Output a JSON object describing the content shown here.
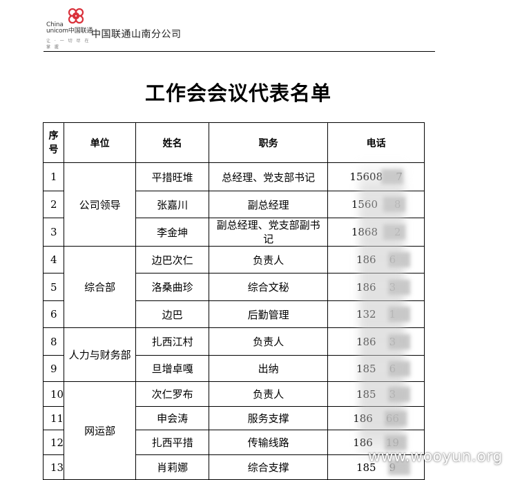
{
  "header": {
    "brand_en_line1": "China",
    "brand_en_line2": "unicom中国联通",
    "slogan": "让 · 一 切 尽 在 掌 握",
    "company": "中国联通山南分公司"
  },
  "title": "工作会会议代表名单",
  "table": {
    "headers": {
      "seq_line1": "序",
      "seq_line2": "号",
      "unit": "单位",
      "name": "姓名",
      "duty": "职务",
      "phone": "电话"
    },
    "groups": [
      {
        "unit": "公司领导",
        "rows": [
          {
            "seq": "1",
            "name": "平措旺堆",
            "duty": "总经理、党支部书记",
            "phone": "15608    7"
          },
          {
            "seq": "2",
            "name": "张嘉川",
            "duty": "副总经理",
            "phone": "1560     8"
          },
          {
            "seq": "3",
            "name": "李金坤",
            "duty": "副总经理、党支部副书记",
            "phone": "1868     2"
          }
        ]
      },
      {
        "unit": "综合部",
        "rows": [
          {
            "seq": "4",
            "name": "边巴次仁",
            "duty": "负责人",
            "phone": "186    6"
          },
          {
            "seq": "5",
            "name": "洛桑曲珍",
            "duty": "综合文秘",
            "phone": "186    3"
          },
          {
            "seq": "6",
            "name": "边巴",
            "duty": "后勤管理",
            "phone": "132    1"
          }
        ]
      },
      {
        "unit": "人力与财务部",
        "rows": [
          {
            "seq": "8",
            "name": "扎西江村",
            "duty": "负责人",
            "phone": "186    3"
          },
          {
            "seq": "9",
            "name": "旦增卓嘎",
            "duty": "出纳",
            "phone": "185    6"
          }
        ]
      },
      {
        "unit": "网运部",
        "rows": [
          {
            "seq": "10",
            "name": "次仁罗布",
            "duty": "负责人",
            "phone": "185    3"
          },
          {
            "seq": "11",
            "name": "申会涛",
            "duty": "服务支撑",
            "phone": "186    66"
          },
          {
            "seq": "12",
            "name": "扎西平措",
            "duty": "传输线路",
            "phone": "186    19"
          },
          {
            "seq": "13",
            "name": "肖莉娜",
            "duty": "综合支撑",
            "phone": "185    9"
          }
        ]
      }
    ]
  },
  "watermark": "www.wooyun.org",
  "colors": {
    "logo_red": "#d9303a",
    "rule": "#000000"
  }
}
